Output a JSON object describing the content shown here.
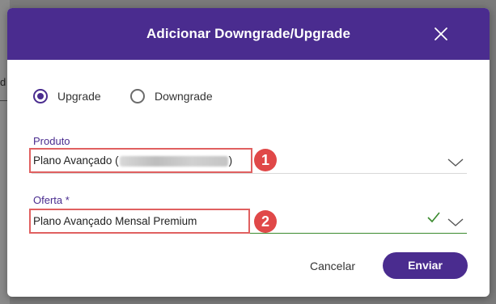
{
  "backdrop": {
    "peek_text": "d"
  },
  "modal": {
    "title": "Adicionar Downgrade/Upgrade",
    "close_icon": "close-icon"
  },
  "radio": {
    "options": [
      {
        "label": "Upgrade",
        "checked": true
      },
      {
        "label": "Downgrade",
        "checked": false
      }
    ]
  },
  "produto": {
    "label": "Produto",
    "value_prefix": "Plano Avançado (",
    "value_suffix": ")",
    "annotation_number": "1"
  },
  "oferta": {
    "label": "Oferta *",
    "value": "Plano Avançado Mensal Premium",
    "annotation_number": "2",
    "valid": true
  },
  "actions": {
    "cancel_label": "Cancelar",
    "submit_label": "Enviar"
  },
  "colors": {
    "primary": "#4a2c8f",
    "annotation": "#e04848",
    "valid_green": "#3a8a2e"
  }
}
